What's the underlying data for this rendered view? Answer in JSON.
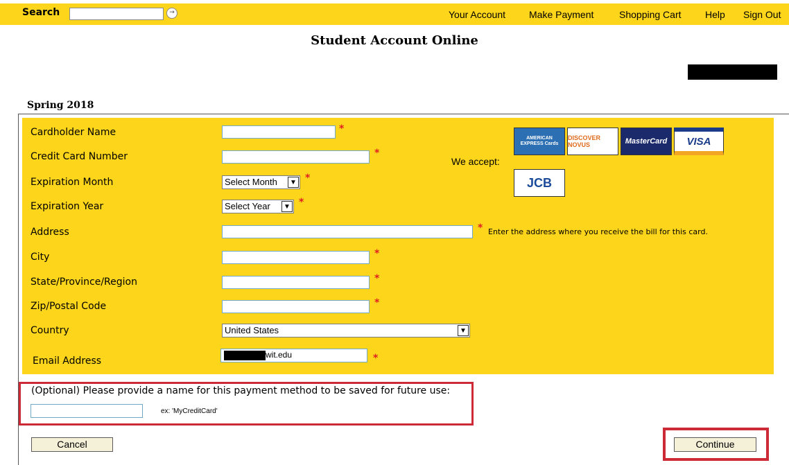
{
  "header": {
    "search_label": "Search",
    "search_value": "",
    "nav": [
      "Your Account",
      "Make Payment",
      "Shopping Cart",
      "Help",
      "Sign Out"
    ]
  },
  "page_title": "Student Account Online",
  "term": "Spring 2018",
  "form": {
    "cardholder_label": "Cardholder Name",
    "card_number_label": "Credit Card Number",
    "exp_month_label": "Expiration Month",
    "exp_month_value": "Select Month",
    "exp_year_label": "Expiration Year",
    "exp_year_value": "Select Year",
    "address_label": "Address",
    "address_note": "Enter the address where you receive the bill for this card.",
    "city_label": "City",
    "state_label": "State/Province/Region",
    "zip_label": "Zip/Postal Code",
    "country_label": "Country",
    "country_value": "United States",
    "email_label": "Email Address",
    "email_visible": "wit.edu",
    "required_mark": "*"
  },
  "accept": {
    "label": "We accept:",
    "cards": [
      "AMERICAN EXPRESS Cards",
      "DISCOVER NOVUS",
      "MasterCard",
      "VISA",
      "JCB"
    ]
  },
  "optional": {
    "prompt": "(Optional) Please provide a name for this payment method to be saved for future use:",
    "value": "",
    "example": "ex: 'MyCreditCard'"
  },
  "buttons": {
    "cancel": "Cancel",
    "continue": "Continue"
  },
  "colors": {
    "panel": "#fdd51a",
    "highlight": "#cc2a36",
    "required": "#e02020"
  }
}
